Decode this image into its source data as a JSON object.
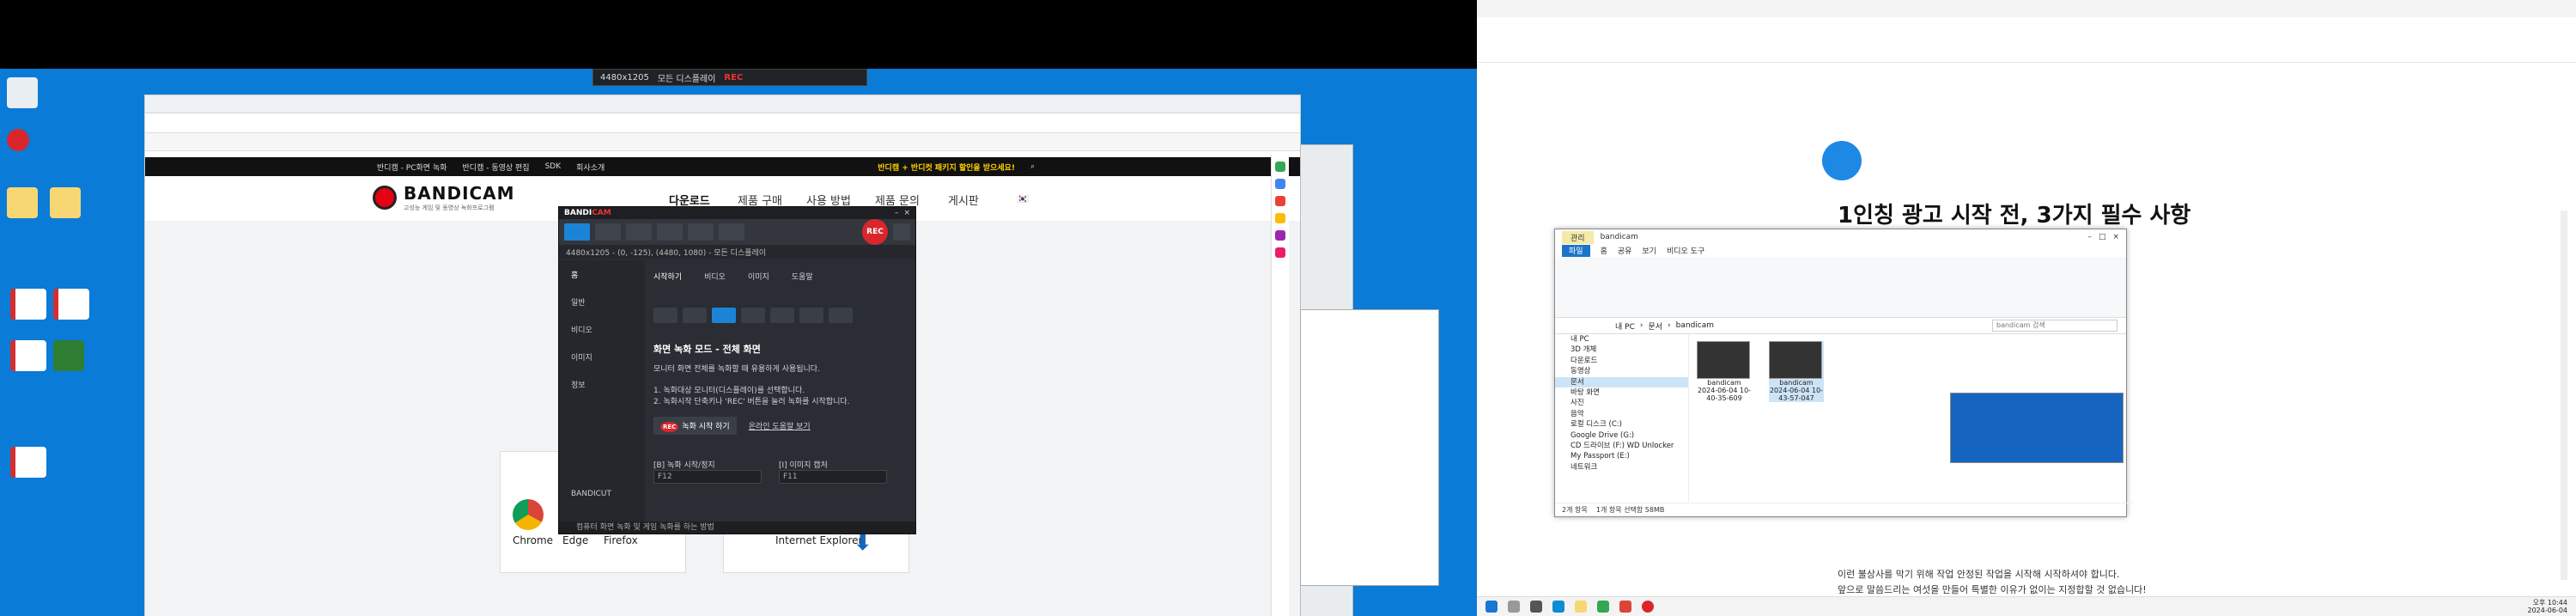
{
  "bandicam_bar": {
    "resolution": "4480x1205",
    "mode": "모든 디스플레이",
    "rec": "REC"
  },
  "site": {
    "top_links": [
      "반디캠 - PC화면 녹화",
      "반디캠 - 동영상 편집",
      "SDK",
      "회사소개"
    ],
    "promo": "반디캠 + 반디컷 패키지 할인을 받으세요!",
    "logo_name": "BANDICAM",
    "logo_sub": "고성능 게임 및 동영상 녹화프로그램",
    "menu": [
      "다운로드",
      "제품 구매",
      "사용 방법",
      "제품 문의",
      "게시판"
    ],
    "browsers": [
      {
        "name": "Chrome",
        "color": "#db4437"
      },
      {
        "name": "Edge",
        "color": "#0c8bd6"
      },
      {
        "name": "Firefox",
        "color": "#ff6a00"
      }
    ],
    "ie_label": "Internet Explorer"
  },
  "bandicam_app": {
    "brand_a": "BANDI",
    "brand_b": "CAM",
    "area_label": "4480x1205 - (0, -125), (4480, 1080) - 모든 디스플레이",
    "rec_label": "REC",
    "sidebar": [
      "홈",
      "일반",
      "비디오",
      "이미지",
      "정보"
    ],
    "tabs": [
      "시작하기",
      "비디오",
      "이미지",
      "도움말"
    ],
    "mode_title": "화면 녹화 모드 - 전체 화면",
    "mode_desc": "모니터 화면 전체를 녹화할 때 유용하게 사용됩니다.",
    "step1": "1. 녹화대상 모니터(디스플레이)를 선택합니다.",
    "step2": "2. 녹화시작 단축키나 'REC' 버튼을 눌러 녹화를 시작합니다.",
    "start_btn": "녹화 시작 하기",
    "help_link": "온라인 도움말 보기",
    "hotkey_rec_label": "[B] 녹화 시작/정지",
    "hotkey_rec": "F12",
    "hotkey_img_label": "[I] 이미지 캡처",
    "hotkey_img": "F11",
    "footer": "컴퓨터 화면 녹화 및 게임 녹화를 하는 방법",
    "bandicut": "BANDICUT"
  },
  "right": {
    "heading": "1인칭 광고 시작 전, 3가지 필수 사항",
    "line1": "이런 불상사를 막기 위해 작업 안정된 작업을 시작해 시작하셔야 합니다.",
    "line2": "앞으로 말씀드리는 여섯을 만들어 특별한 이유가 없이는 지정합할 것 없습니다!",
    "clock_time": "오후 10:44",
    "clock_date": "2024-06-04"
  },
  "explorer": {
    "manage": "관리",
    "folder": "bandicam",
    "tabs": [
      "파일",
      "홈",
      "공유",
      "보기",
      "비디오 도구"
    ],
    "path": [
      "내 PC",
      "문서",
      "bandicam"
    ],
    "search": "bandicam 검색",
    "nav": [
      "내 PC",
      "3D 개체",
      "다운로드",
      "동영상",
      "문서",
      "바탕 화면",
      "사진",
      "음악",
      "로컬 디스크 (C:)",
      "Google Drive (G:)",
      "CD 드라이브 (F:) WD Unlocker",
      "My Passport (E:)",
      "네트워크"
    ],
    "files": [
      {
        "name": "bandicam 2024-06-04 10-40-35-609"
      },
      {
        "name": "bandicam 2024-06-04 10-43-57-047"
      }
    ],
    "status_count": "2개 항목",
    "status_sel": "1개 항목 선택함 58MB"
  }
}
